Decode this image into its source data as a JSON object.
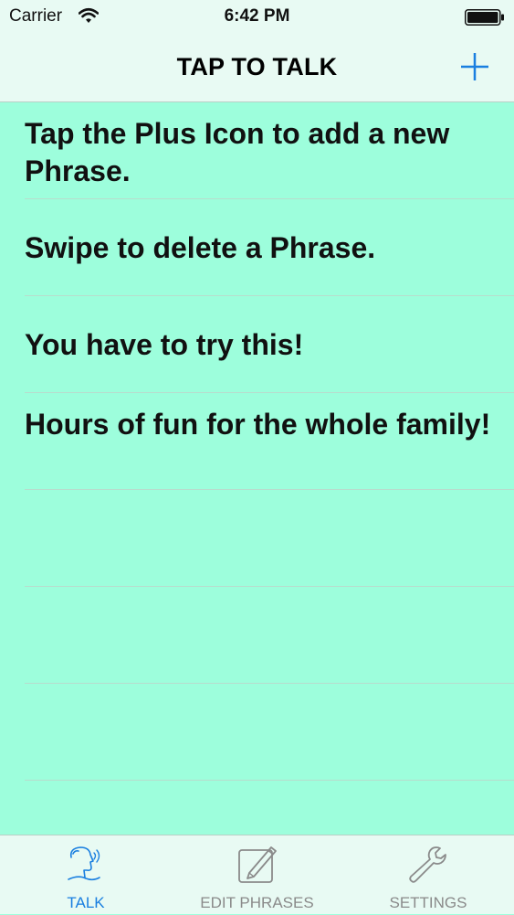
{
  "status_bar": {
    "carrier": "Carrier",
    "time": "6:42 PM",
    "wifi_icon": "wifi-icon",
    "battery_icon": "battery-icon"
  },
  "nav_bar": {
    "title": "TAP TO TALK",
    "add_icon": "plus-icon"
  },
  "phrases": [
    "Tap the Plus Icon to add a new Phrase.",
    "Swipe to delete a Phrase.",
    "You have to try this!",
    "Hours of fun for the whole family!",
    "",
    "",
    "",
    ""
  ],
  "tabs": [
    {
      "label": "TALK",
      "icon": "talk-icon",
      "selected": true
    },
    {
      "label": "EDIT PHRASES",
      "icon": "edit-icon",
      "selected": false
    },
    {
      "label": "SETTINGS",
      "icon": "wrench-icon",
      "selected": false
    }
  ],
  "colors": {
    "background": "#9dfedc",
    "bars": "#e8faf3",
    "accent": "#1a7fe0",
    "inactive": "#8a8a8a"
  }
}
